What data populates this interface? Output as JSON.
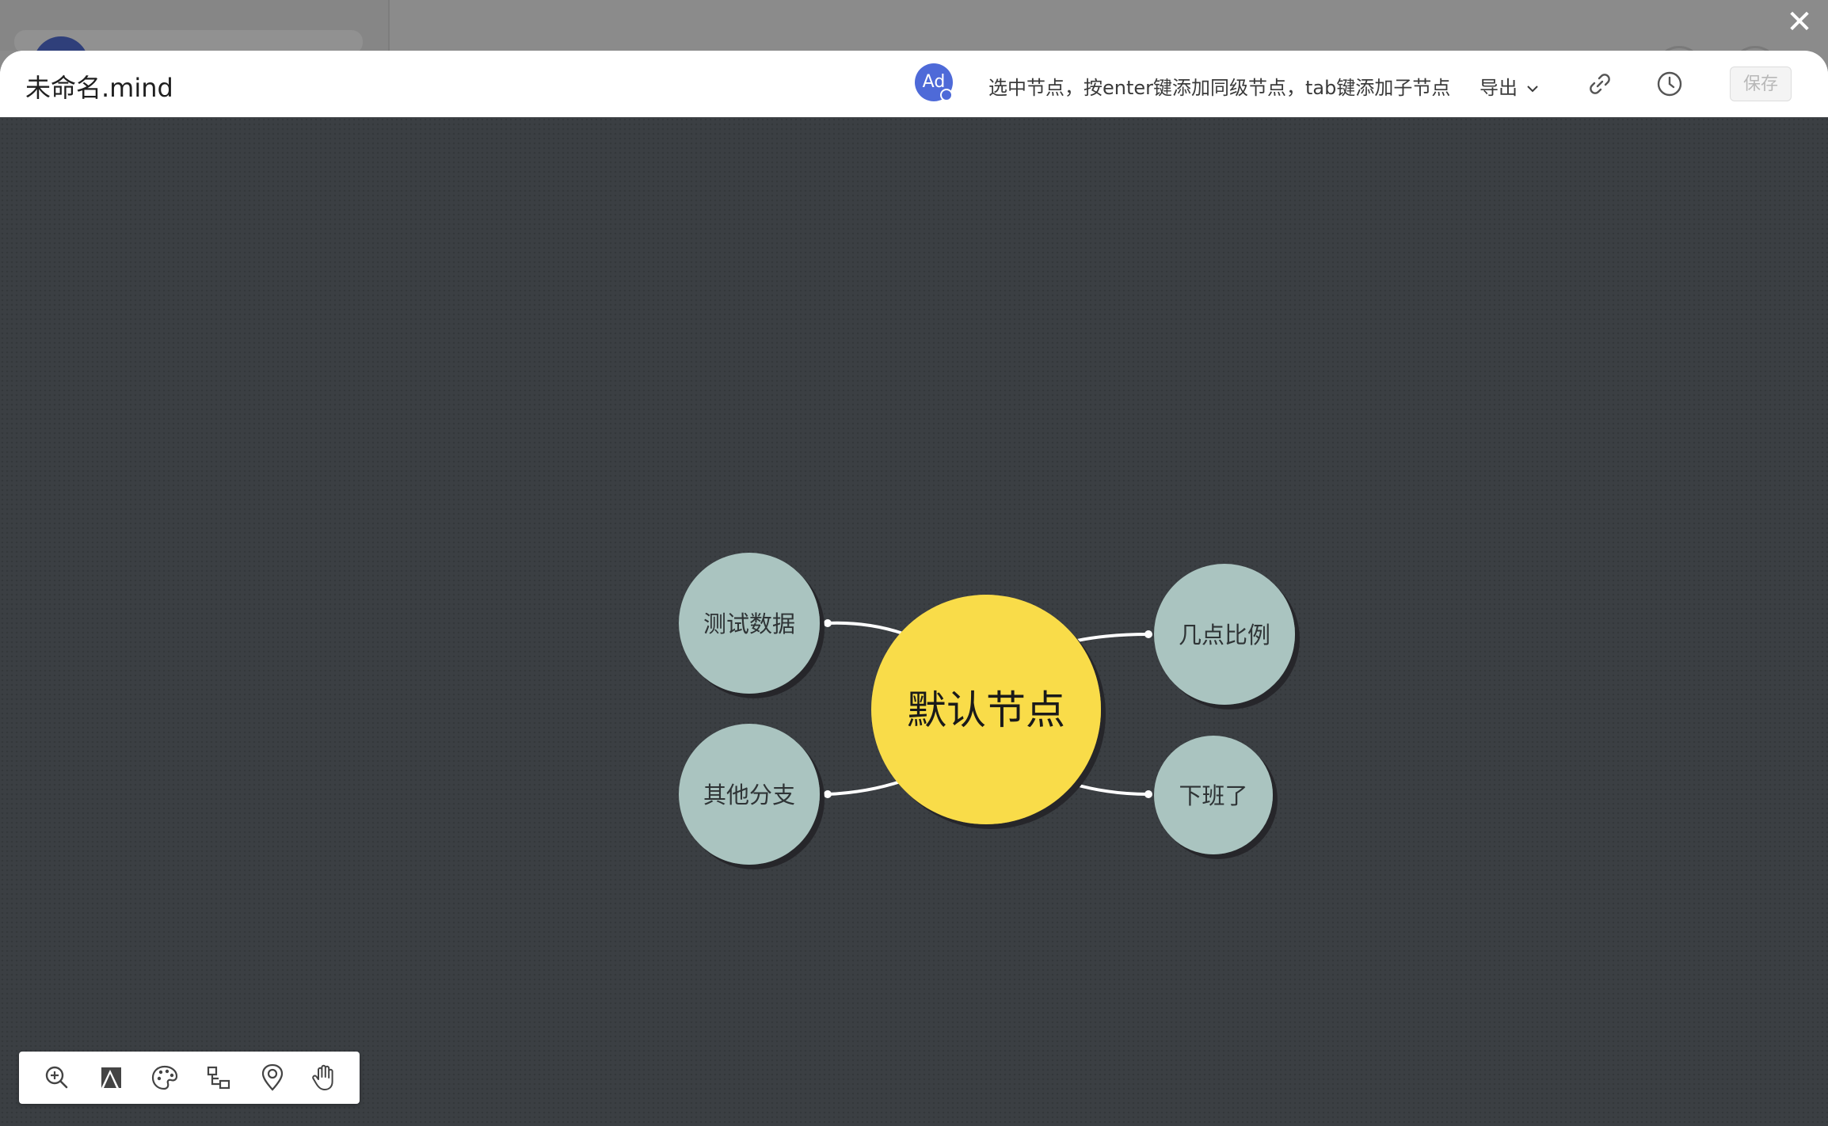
{
  "window": {
    "close_glyph": "✕"
  },
  "header": {
    "doc_title": "未命名.mind",
    "avatar_initials": "Ad",
    "hint": "选中节点，按enter键添加同级节点，tab键添加子节点",
    "export_label": "导出",
    "link_icon": "link-icon",
    "history_icon": "clock-icon",
    "save_label": "保存"
  },
  "mindmap": {
    "root": {
      "label": "默认节点",
      "color": "#f9dc4a"
    },
    "branch_color": "#aac4c0",
    "children": [
      {
        "label": "测试数据",
        "side": "left"
      },
      {
        "label": "其他分支",
        "side": "left"
      },
      {
        "label": "几点比例",
        "side": "right"
      },
      {
        "label": "下班了",
        "side": "right"
      }
    ]
  },
  "toolbar": {
    "items": [
      {
        "name": "zoom-in-icon"
      },
      {
        "name": "theme-icon"
      },
      {
        "name": "palette-icon"
      },
      {
        "name": "structure-icon"
      },
      {
        "name": "locate-icon"
      },
      {
        "name": "hand-icon"
      }
    ]
  },
  "colors": {
    "canvas_bg": "#3b3f43",
    "accent": "#4e6ad8",
    "root_node": "#f9dc4a",
    "branch_node": "#aac4c0"
  }
}
